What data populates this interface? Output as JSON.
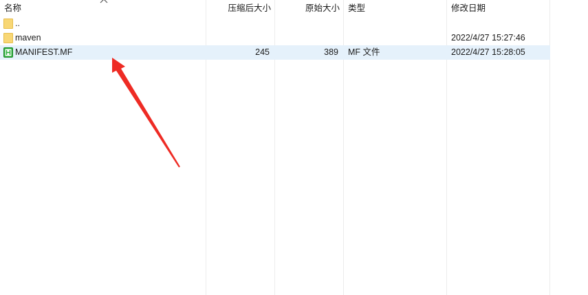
{
  "columns": {
    "name": "名称",
    "compressed_size": "压缩后大小",
    "original_size": "原始大小",
    "type": "类型",
    "modified": "修改日期"
  },
  "sort_indicator": "chevron-up-icon",
  "files": [
    {
      "name": "..",
      "compressed_size": "",
      "original_size": "",
      "type": "",
      "modified": "",
      "icon": "folder-icon",
      "selected": false
    },
    {
      "name": "maven",
      "compressed_size": "",
      "original_size": "",
      "type": "",
      "modified": "2022/4/27 15:27:46",
      "icon": "folder-icon",
      "selected": false
    },
    {
      "name": "MANIFEST.MF",
      "compressed_size": "245",
      "original_size": "389",
      "type": "MF 文件",
      "modified": "2022/4/27 15:28:05",
      "icon": "html-file-icon",
      "selected": true
    }
  ],
  "colors": {
    "selection": "#e5f1fb",
    "annotation_arrow": "#ee2b24",
    "folder": "#f8d775",
    "file_icon": "#2bae3a"
  }
}
